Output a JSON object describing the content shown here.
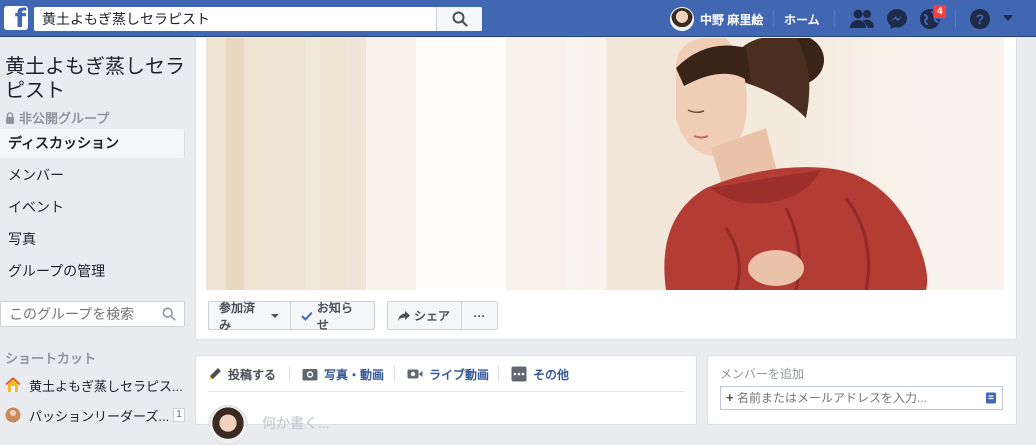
{
  "topbar": {
    "search_value": "黄土よもぎ蒸しセラピスト",
    "profile_name": "中野 麻里絵",
    "home_label": "ホーム",
    "notification_count": "4",
    "brand_color": "#4267b2"
  },
  "sidebar": {
    "group_name": "黄土よもぎ蒸しセラピスト",
    "privacy_label": "非公開グループ",
    "nav": [
      {
        "label": "ディスカッション",
        "active": true
      },
      {
        "label": "メンバー"
      },
      {
        "label": "イベント"
      },
      {
        "label": "写真"
      },
      {
        "label": "グループの管理"
      }
    ],
    "search_placeholder": "このグループを検索",
    "shortcuts_title": "ショートカット",
    "shortcuts": [
      {
        "label": "黄土よもぎ蒸しセラピス...",
        "icon": "house-icon"
      },
      {
        "label": "パッションリーダーズ...",
        "icon": "group-icon",
        "count": "1"
      }
    ]
  },
  "group_actions": {
    "joined_label": "参加済み",
    "notify_label": "お知らせ",
    "share_label": "シェア",
    "more_label": "···"
  },
  "composer": {
    "tabs": [
      "投稿する",
      "写真・動画",
      "ライブ動画",
      "その他"
    ],
    "placeholder": "何か書く..."
  },
  "add_member": {
    "title": "メンバーを追加",
    "placeholder": "名前またはメールアドレスを入力..."
  }
}
